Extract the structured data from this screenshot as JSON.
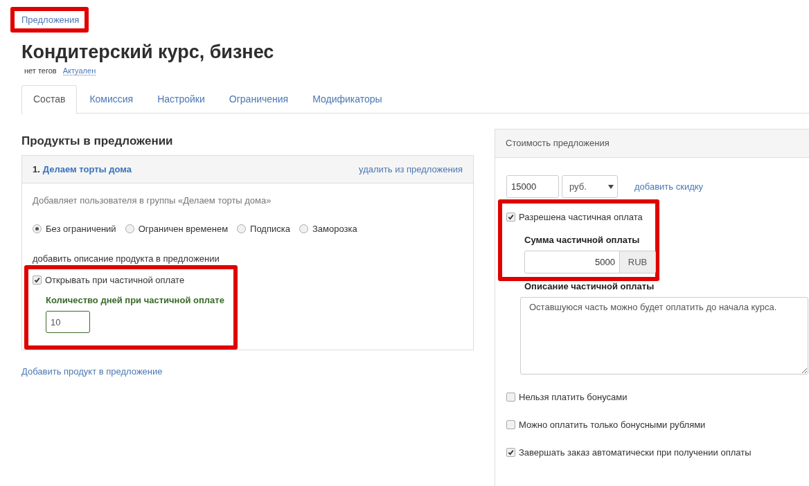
{
  "breadcrumb": {
    "label": "Предложения",
    "highlighted": true
  },
  "title": "Кондитерский курс, бизнес",
  "tags": {
    "label": "нет тегов",
    "status": "Актуален"
  },
  "tabs": [
    {
      "label": "Состав",
      "selected": true
    },
    {
      "label": "Комиссия",
      "selected": false
    },
    {
      "label": "Настройки",
      "selected": false
    },
    {
      "label": "Ограничения",
      "selected": false
    },
    {
      "label": "Модификаторы",
      "selected": false
    }
  ],
  "products": {
    "heading": "Продукты в предложении",
    "items": [
      {
        "number": "1.",
        "name": "Делаем торты дома",
        "remove_link": "удалить из предложения",
        "description": "Добавляет пользователя в группы «Делаем торты дома»",
        "access_options": [
          {
            "label": "Без ограничений",
            "selected": true
          },
          {
            "label": "Ограничен временем",
            "selected": false
          },
          {
            "label": "Подписка",
            "selected": false
          },
          {
            "label": "Заморозка",
            "selected": false
          }
        ],
        "add_description_link": "добавить описание продукта в предложении",
        "partial_payment": {
          "label": "Открывать при частичной оплате",
          "checked": true,
          "highlighted": true,
          "days_label": "Количество дней при частичной оплате",
          "days_value": "10"
        }
      }
    ],
    "add_product_link": "Добавить продукт в предложение"
  },
  "pricing": {
    "heading": "Стоимость предложения",
    "price_value": "15000",
    "currency": "руб.",
    "discount_link": "добавить скидку",
    "partial": {
      "label": "Разрешена частичная оплата",
      "checked": true,
      "highlighted": true,
      "amount_label": "Сумма частичной оплаты",
      "amount_value": "5000",
      "amount_unit": "RUB",
      "description_label": "Описание частичной оплаты",
      "description_value": "Оставшуюся часть можно будет оплатить до начала курса."
    },
    "options": [
      {
        "label": "Нельзя платить бонусами",
        "checked": false
      },
      {
        "label": "Можно оплатить только бонусными рублями",
        "checked": false
      },
      {
        "label": "Завершать заказ автоматически при получении оплаты",
        "checked": true
      }
    ]
  }
}
